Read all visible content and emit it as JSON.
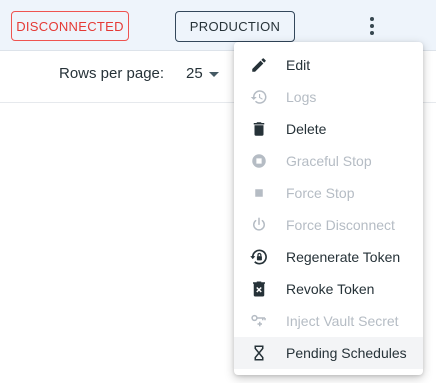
{
  "row": {
    "status_badge": "DISCONNECTED",
    "environment_badge": "PRODUCTION"
  },
  "pagination": {
    "rows_per_page_label": "Rows per page:",
    "rows_per_page_value": "25"
  },
  "menu": {
    "items": [
      {
        "label": "Edit",
        "icon": "pencil-icon",
        "disabled": false
      },
      {
        "label": "Logs",
        "icon": "history-icon",
        "disabled": true
      },
      {
        "label": "Delete",
        "icon": "trash-icon",
        "disabled": false
      },
      {
        "label": "Graceful Stop",
        "icon": "stop-circle-icon",
        "disabled": true
      },
      {
        "label": "Force Stop",
        "icon": "stop-square-icon",
        "disabled": true
      },
      {
        "label": "Force Disconnect",
        "icon": "power-icon",
        "disabled": true
      },
      {
        "label": "Regenerate Token",
        "icon": "lock-reset-icon",
        "disabled": false
      },
      {
        "label": "Revoke Token",
        "icon": "delete-box-icon",
        "disabled": false
      },
      {
        "label": "Inject Vault Secret",
        "icon": "key-plus-icon",
        "disabled": true
      },
      {
        "label": "Pending Schedules",
        "icon": "hourglass-icon",
        "disabled": false
      }
    ]
  },
  "colors": {
    "danger": "#e53935",
    "text": "#263238",
    "disabled_text": "#b5bcc4",
    "row_highlight": "#eef4fb"
  }
}
